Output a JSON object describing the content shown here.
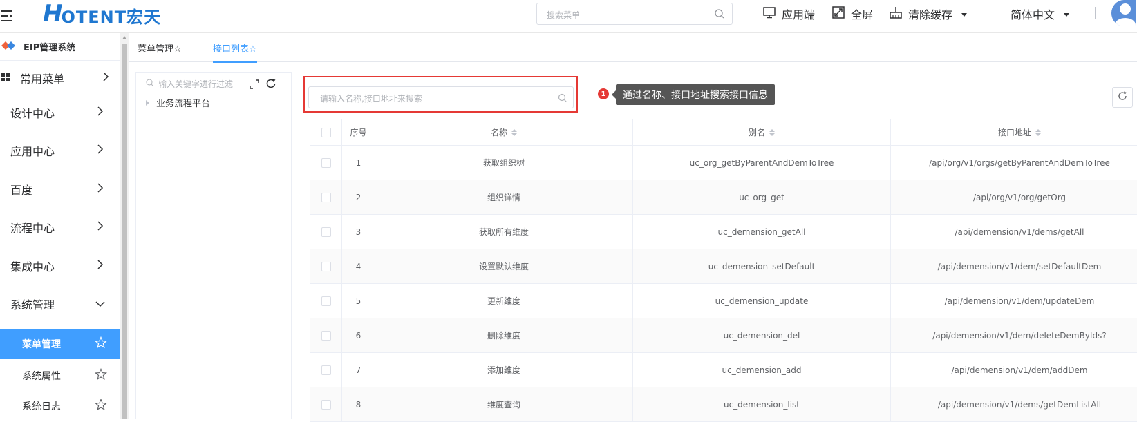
{
  "header": {
    "logo_mark": "H",
    "logo_text": "OTENT宏天",
    "search_placeholder": "搜索菜单",
    "app_client": "应用端",
    "fullscreen": "全屏",
    "clear_cache": "清除缓存",
    "language": "简体中文"
  },
  "sidebar": {
    "system_title": "EIP管理系统",
    "menus": [
      {
        "label": "常用菜单"
      },
      {
        "label": "设计中心"
      },
      {
        "label": "应用中心"
      },
      {
        "label": "百度"
      },
      {
        "label": "流程中心"
      },
      {
        "label": "集成中心"
      },
      {
        "label": "系统管理"
      }
    ],
    "sub_items": [
      {
        "label": "菜单管理",
        "active": true
      },
      {
        "label": "系统属性",
        "active": false
      },
      {
        "label": "系统日志",
        "active": false
      }
    ]
  },
  "tabs": [
    {
      "label": "菜单管理☆",
      "active": false
    },
    {
      "label": "接口列表☆",
      "active": true
    }
  ],
  "tree": {
    "filter_placeholder": "输入关键字进行过滤",
    "root_node": "业务流程平台"
  },
  "api_search": {
    "placeholder": "请输入名称,接口地址来搜索"
  },
  "callout": {
    "number": "1",
    "text": "通过名称、接口地址搜索接口信息"
  },
  "table": {
    "headers": {
      "index": "序号",
      "name": "名称",
      "alias": "别名",
      "path": "接口地址"
    },
    "rows": [
      {
        "index": "1",
        "name": "获取组织树",
        "alias": "uc_org_getByParentAndDemToTree",
        "path": "/api/org/v1/orgs/getByParentAndDemToTree"
      },
      {
        "index": "2",
        "name": "组织详情",
        "alias": "uc_org_get",
        "path": "/api/org/v1/org/getOrg"
      },
      {
        "index": "3",
        "name": "获取所有维度",
        "alias": "uc_demension_getAll",
        "path": "/api/demension/v1/dems/getAll"
      },
      {
        "index": "4",
        "name": "设置默认维度",
        "alias": "uc_demension_setDefault",
        "path": "/api/demension/v1/dem/setDefaultDem"
      },
      {
        "index": "5",
        "name": "更新维度",
        "alias": "uc_demension_update",
        "path": "/api/demension/v1/dem/updateDem"
      },
      {
        "index": "6",
        "name": "删除维度",
        "alias": "uc_demension_del",
        "path": "/api/demension/v1/dem/deleteDemByIds?"
      },
      {
        "index": "7",
        "name": "添加维度",
        "alias": "uc_demension_add",
        "path": "/api/demension/v1/dem/addDem"
      },
      {
        "index": "8",
        "name": "维度查询",
        "alias": "uc_demension_list",
        "path": "/api/demension/v1/dems/getDemListAll"
      }
    ]
  }
}
